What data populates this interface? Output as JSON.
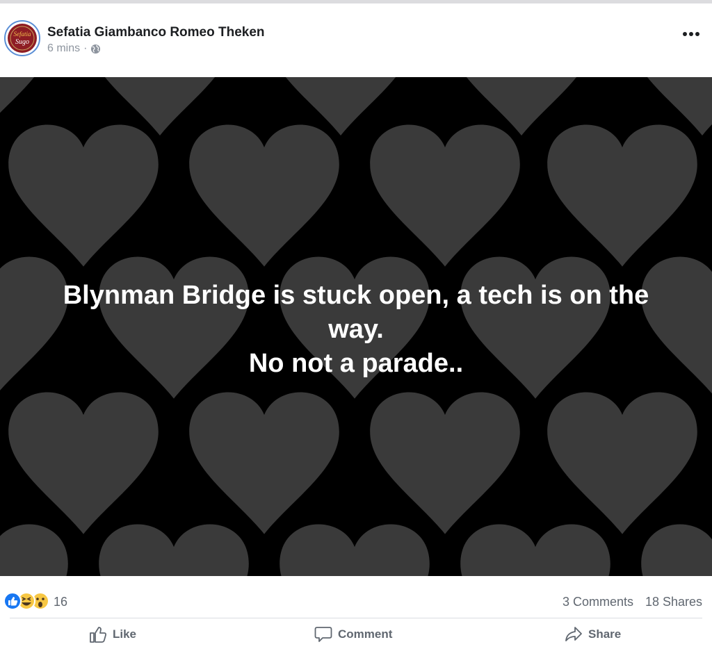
{
  "post": {
    "author": "Sefatia Giambanco Romeo Theken",
    "timestamp": "6 mins",
    "separator": "·",
    "privacy_icon": "globe-icon",
    "avatar_text": {
      "line1": "Sefatia",
      "line2": "Sugo"
    },
    "more_icon": "more-options-icon"
  },
  "image": {
    "background_color": "#000000",
    "heart_color": "#3a3a3a",
    "text_line1": "Blynman Bridge is stuck open, a tech is on the way.",
    "text_line2": "No not a parade.."
  },
  "engagement": {
    "reaction_icons": [
      "like-reaction-icon",
      "haha-reaction-icon",
      "wow-reaction-icon"
    ],
    "reaction_count": "16",
    "comments": "3 Comments",
    "shares": "18 Shares"
  },
  "actions": {
    "like": "Like",
    "comment": "Comment",
    "share": "Share"
  },
  "colors": {
    "avatar_border": "#5b8fd6",
    "avatar_fill": "#8e1d24",
    "like_blue": "#1877f2",
    "emoji_yellow": "#f7c744",
    "secondary_text": "#606770"
  }
}
